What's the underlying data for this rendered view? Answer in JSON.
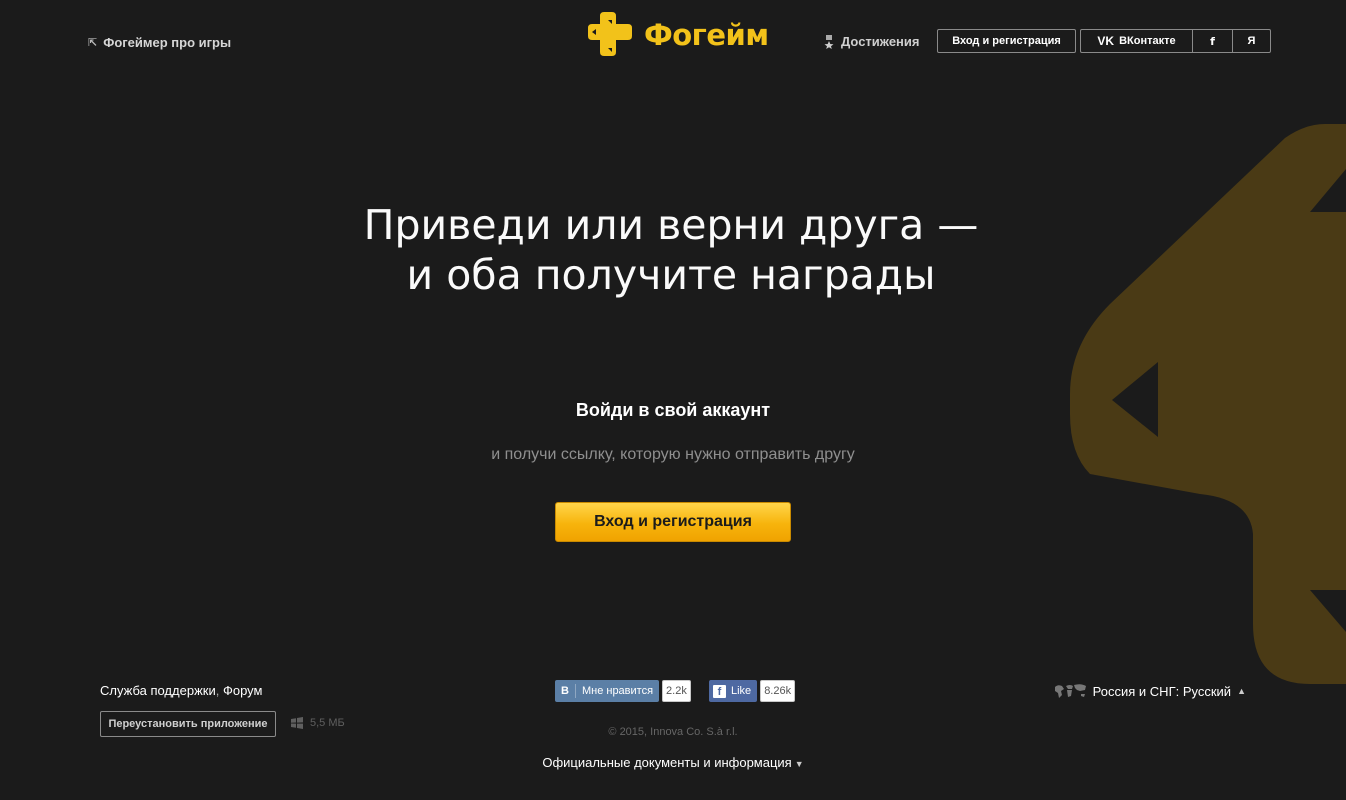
{
  "header": {
    "back_link": "Фогеймер про игры",
    "logo_text": "Фогейм",
    "achievements": "Достижения",
    "login_button": "Вход и регистрация",
    "vk_button": "ВКонтакте",
    "fb_button": "f",
    "ya_button": "Я"
  },
  "main": {
    "headline_line1": "Приведи или верни друга —",
    "headline_line2": "и оба получите награды",
    "subheading": "Войди в свой аккаунт",
    "description": "и получи ссылку, которую нужно отправить другу",
    "cta_button": "Вход и регистрация"
  },
  "footer": {
    "support_link": "Служба поддержки",
    "separator": ",",
    "forum_link": "Форум",
    "reinstall_button": "Переустановить приложение",
    "installer_size": "5,5 МБ",
    "vk_like": {
      "logo": "В",
      "label": "Мне нравится",
      "count": "2.2k"
    },
    "fb_like": {
      "logo": "f",
      "label": "Like",
      "count": "8.26k"
    },
    "copyright": "© 2015, Innova Co. S.à r.l.",
    "documents_link": "Официальные документы и информация",
    "region_link": "Россия и СНГ: Русский"
  },
  "colors": {
    "background": "#1b1b1b",
    "brand_yellow": "#f2c21a",
    "cta_gradient_top": "#ffd54a",
    "cta_gradient_bottom": "#f0a300",
    "decor_logo": "#4a3a15"
  },
  "icons": [
    "arrow-up-left-icon",
    "forgame-logo-icon",
    "medal-icon",
    "vk-icon",
    "facebook-icon",
    "yandex-icon",
    "windows-icon",
    "world-map-icon",
    "caret-down-icon",
    "caret-up-icon"
  ]
}
